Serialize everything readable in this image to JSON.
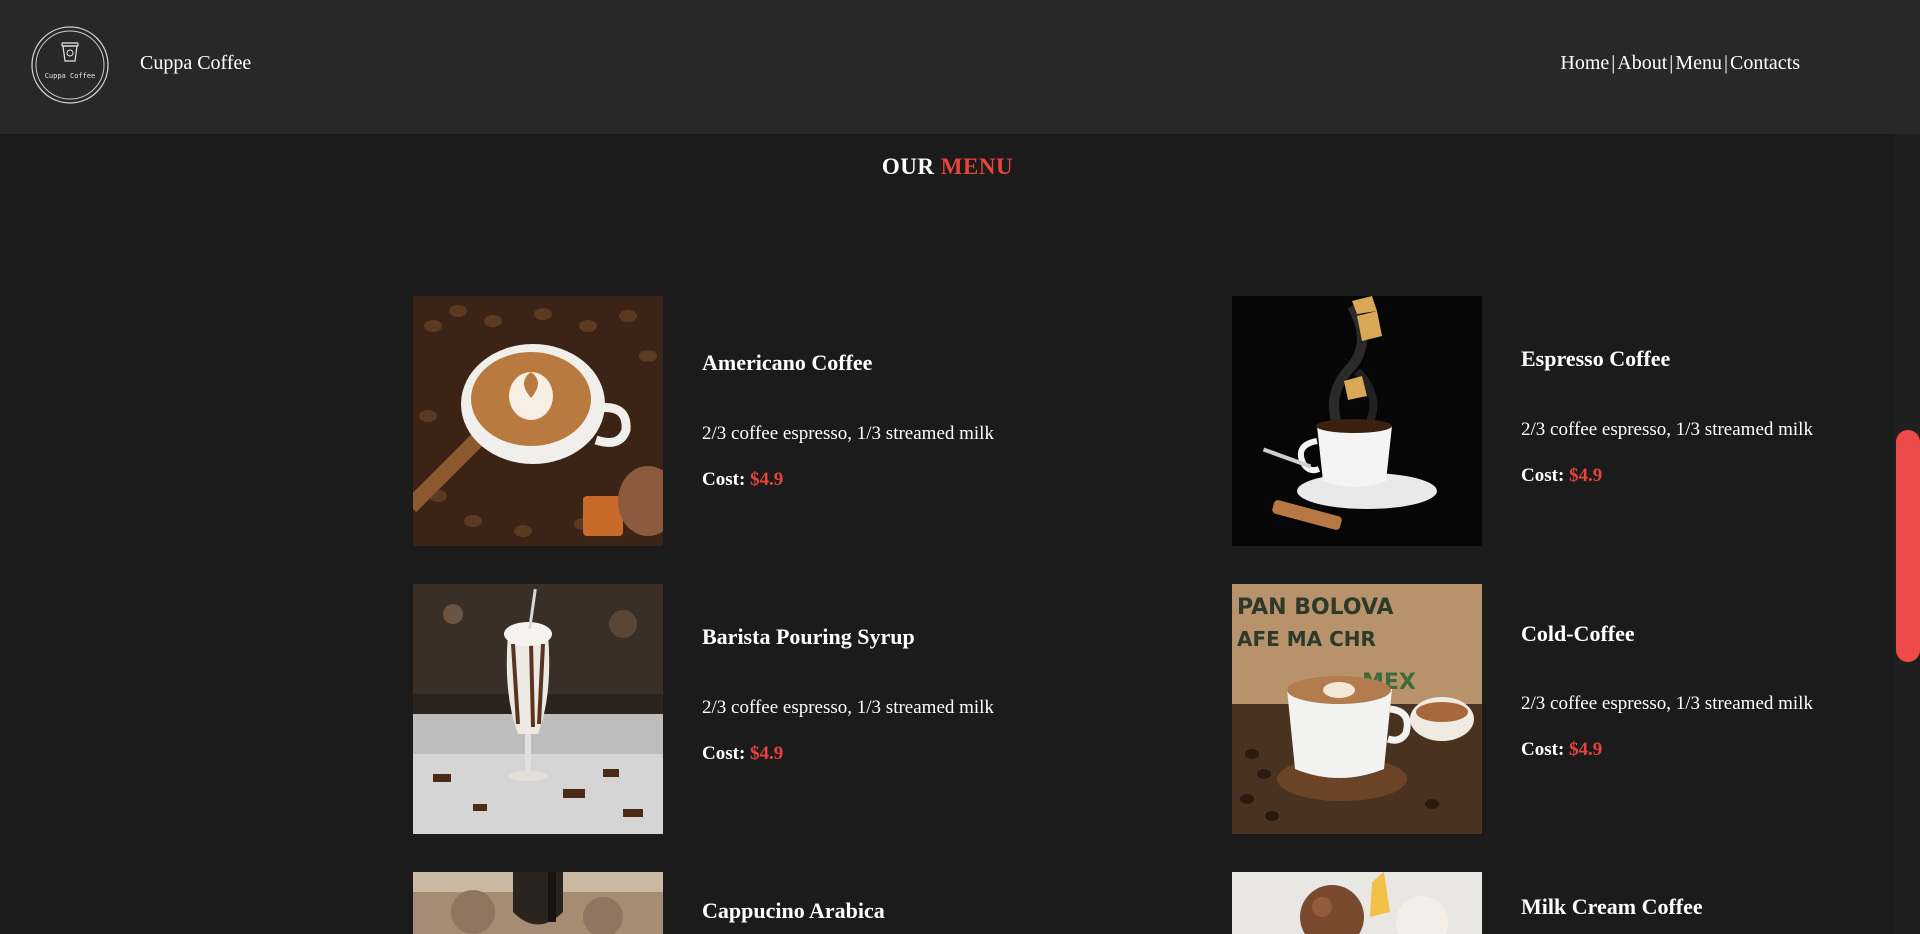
{
  "header": {
    "logo_text": "Cuppa Coffee",
    "brand": "Cuppa Coffee",
    "nav": [
      {
        "label": "Home"
      },
      {
        "label": "About"
      },
      {
        "label": "Menu"
      },
      {
        "label": "Contacts"
      }
    ],
    "nav_separator": "|"
  },
  "menu": {
    "title_part1": "OUR",
    "title_part2": "MENU",
    "cost_label": "Cost:",
    "items": [
      {
        "name": "Americano Coffee",
        "description": "2/3 coffee espresso, 1/3 streamed milk",
        "price": "$4.9"
      },
      {
        "name": "Espresso Coffee",
        "description": "2/3 coffee espresso, 1/3 streamed milk",
        "price": "$4.9"
      },
      {
        "name": "Barista Pouring Syrup",
        "description": "2/3 coffee espresso, 1/3 streamed milk",
        "price": "$4.9"
      },
      {
        "name": "Cold-Coffee",
        "description": "2/3 coffee espresso, 1/3 streamed milk",
        "price": "$4.9"
      },
      {
        "name": "Cappucino Arabica",
        "description": "",
        "price": ""
      },
      {
        "name": "Milk Cream Coffee",
        "description": "",
        "price": ""
      }
    ]
  },
  "colors": {
    "accent": "#e8423d",
    "header_bg": "#282828",
    "page_bg": "#1b1b1b",
    "scroll_thumb": "#ef4a4a"
  }
}
